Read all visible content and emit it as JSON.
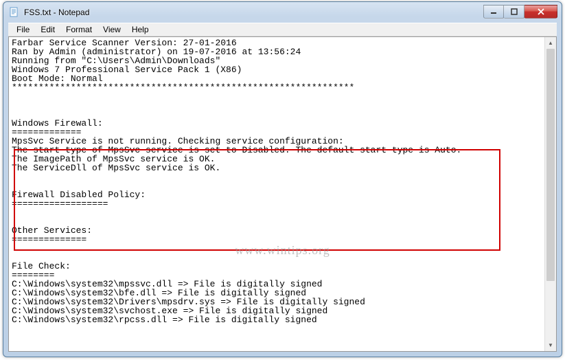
{
  "window": {
    "title": "FSS.txt - Notepad"
  },
  "menu": {
    "file": "File",
    "edit": "Edit",
    "format": "Format",
    "view": "View",
    "help": "Help"
  },
  "content": {
    "text": "Farbar Service Scanner Version: 27-01-2016\nRan by Admin (administrator) on 19-07-2016 at 13:56:24\nRunning from \"C:\\Users\\Admin\\Downloads\"\nWindows 7 Professional Service Pack 1 (X86)\nBoot Mode: Normal\n****************************************************************\n\n\n\nWindows Firewall:\n=============\nMpsSvc Service is not running. Checking service configuration:\nThe start type of MpsSvc service is set to Disabled. The default start type is Auto.\nThe ImagePath of MpsSvc service is OK.\nThe ServiceDll of MpsSvc service is OK.\n\n\nFirewall Disabled Policy:\n==================\n\n\nOther Services:\n==============\n\n\nFile Check:\n========\nC:\\Windows\\system32\\mpssvc.dll => File is digitally signed\nC:\\Windows\\system32\\bfe.dll => File is digitally signed\nC:\\Windows\\system32\\Drivers\\mpsdrv.sys => File is digitally signed\nC:\\Windows\\system32\\svchost.exe => File is digitally signed\nC:\\Windows\\system32\\rpcss.dll => File is digitally signed"
  },
  "watermark": "www.wintips.org"
}
